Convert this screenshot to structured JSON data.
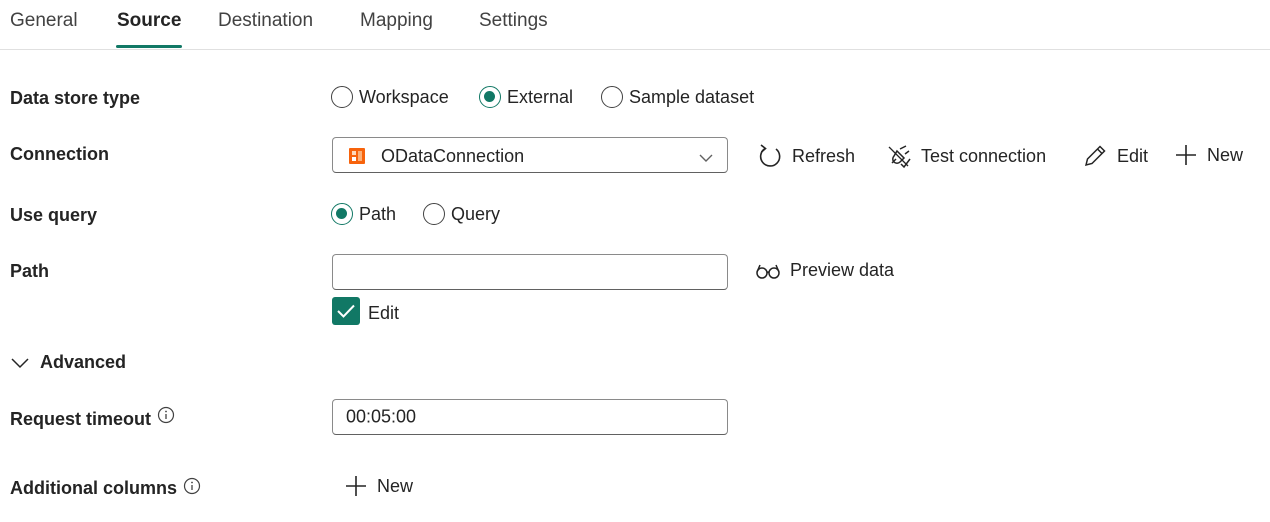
{
  "tabs": [
    "General",
    "Source",
    "Destination",
    "Mapping",
    "Settings"
  ],
  "active_tab": "Source",
  "colors": {
    "accent": "#117865",
    "odata_orange": "#f7630c"
  },
  "data_store_type": {
    "label": "Data store type",
    "options": [
      "Workspace",
      "External",
      "Sample dataset"
    ],
    "selected": "External"
  },
  "connection": {
    "label": "Connection",
    "value": "ODataConnection",
    "icon": "odata-icon",
    "actions": {
      "refresh": "Refresh",
      "test": "Test connection",
      "edit": "Edit",
      "new": "New"
    }
  },
  "use_query": {
    "label": "Use query",
    "options": [
      "Path",
      "Query"
    ],
    "selected": "Path"
  },
  "path": {
    "label": "Path",
    "value": "",
    "preview": "Preview data",
    "edit_checkbox_label": "Edit",
    "edit_checked": true
  },
  "advanced": {
    "label": "Advanced",
    "expanded": true
  },
  "request_timeout": {
    "label": "Request timeout",
    "value": "00:05:00"
  },
  "additional_columns": {
    "label": "Additional columns",
    "new": "New"
  }
}
